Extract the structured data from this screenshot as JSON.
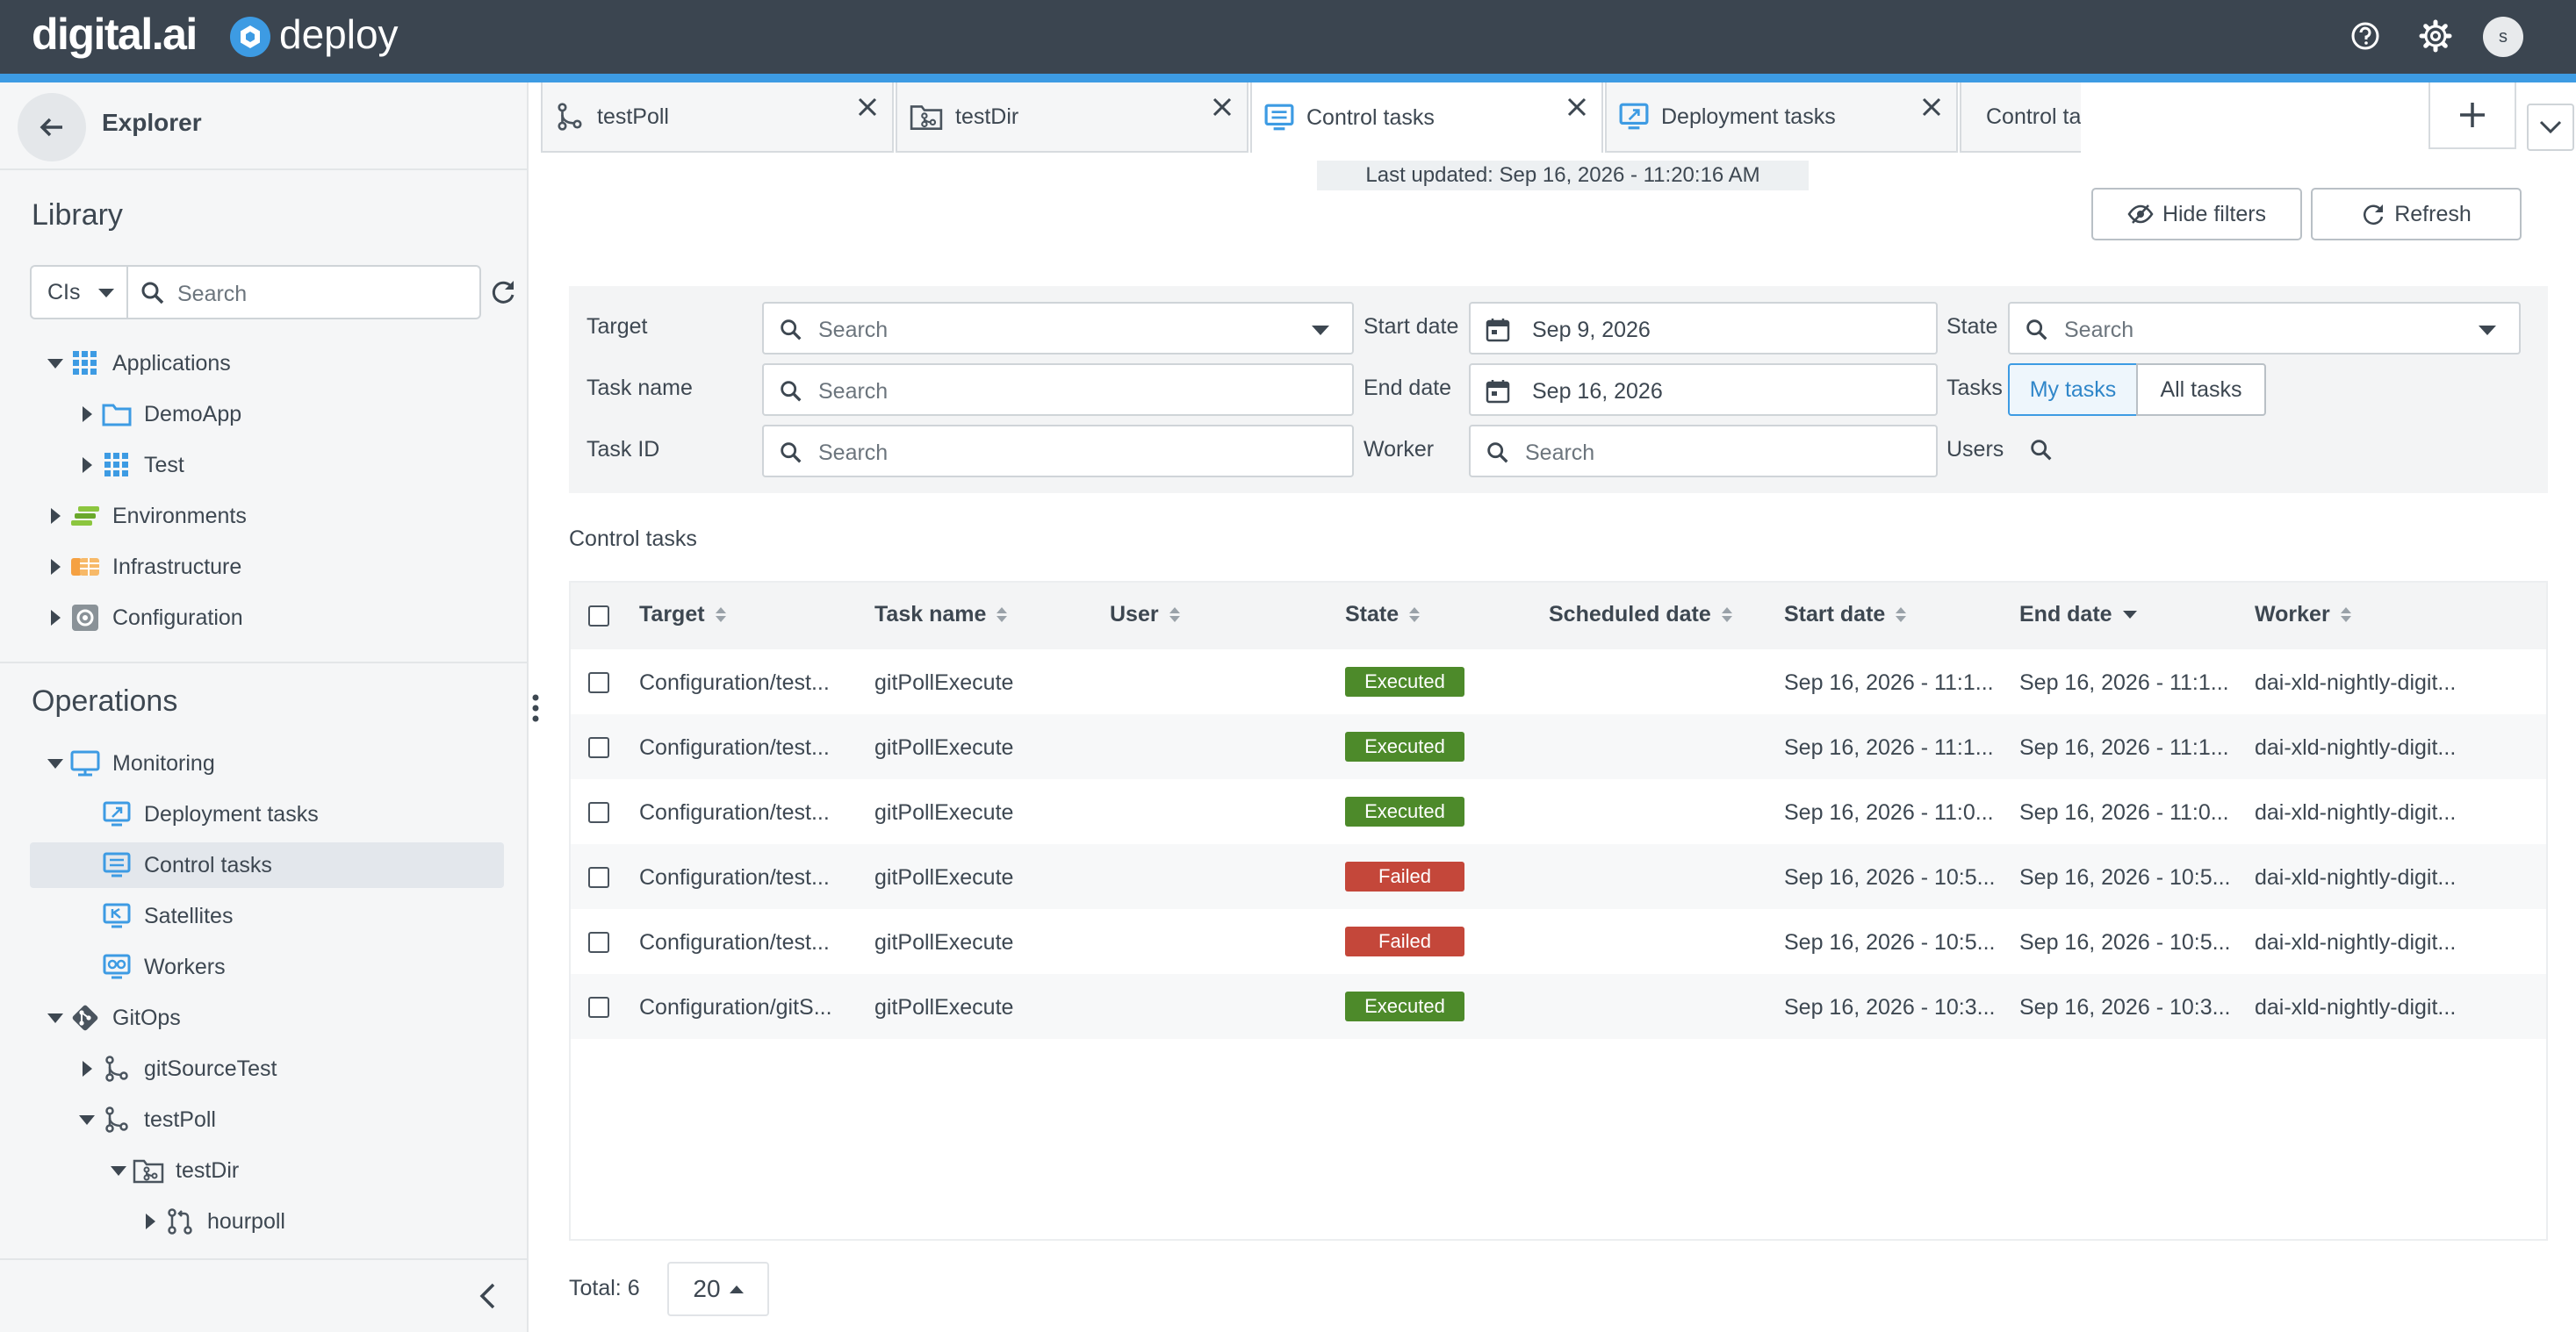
{
  "header": {
    "brand": "digital.ai",
    "product": "deploy",
    "user_initial": "s",
    "icons": [
      "help-icon",
      "settings-icon"
    ],
    "colors": {
      "bar": "#3b4550",
      "accent": "#3d9be3"
    }
  },
  "sidebar": {
    "title": "Explorer",
    "library_heading": "Library",
    "ci_select": "CIs",
    "search_placeholder": "Search",
    "tree": {
      "applications": "Applications",
      "demoapp": "DemoApp",
      "test": "Test",
      "environments": "Environments",
      "infrastructure": "Infrastructure",
      "configuration": "Configuration"
    },
    "operations_heading": "Operations",
    "ops": {
      "monitoring": "Monitoring",
      "deployment_tasks": "Deployment tasks",
      "control_tasks": "Control tasks",
      "satellites": "Satellites",
      "workers": "Workers",
      "gitops": "GitOps",
      "git_source_test": "gitSourceTest",
      "test_poll": "testPoll",
      "test_dir": "testDir",
      "hourpoll": "hourpoll"
    }
  },
  "tabs": [
    {
      "label": "testPoll"
    },
    {
      "label": "testDir"
    },
    {
      "label": "Control tasks"
    },
    {
      "label": "Deployment tasks"
    },
    {
      "label": "Control task [Execute Poll Now] for Confi"
    }
  ],
  "main": {
    "last_updated": "Last updated: Sep 16, 2026 - 11:20:16 AM",
    "hide_filters": "Hide filters",
    "refresh": "Refresh",
    "section_title": "Control tasks",
    "total": "Total: 6",
    "page_size": "20"
  },
  "filters": {
    "target_label": "Target",
    "task_name_label": "Task name",
    "task_id_label": "Task ID",
    "start_date_label": "Start date",
    "end_date_label": "End date",
    "worker_label": "Worker",
    "state_label": "State",
    "tasks_label": "Tasks",
    "users_label": "Users",
    "search_placeholder": "Search",
    "start_date": "Sep 9, 2026",
    "end_date": "Sep 16, 2026",
    "my_tasks": "My tasks",
    "all_tasks": "All tasks"
  },
  "table": {
    "columns": [
      "Target",
      "Task name",
      "User",
      "State",
      "Scheduled date",
      "Start date",
      "End date",
      "Worker"
    ],
    "rows": [
      {
        "target": "Configuration/test...",
        "task": "gitPollExecute",
        "user": "",
        "state": "Executed",
        "scheduled": "",
        "start": "Sep 16, 2026 - 11:1...",
        "end": "Sep 16, 2026 - 11:1...",
        "worker": "dai-xld-nightly-digit..."
      },
      {
        "target": "Configuration/test...",
        "task": "gitPollExecute",
        "user": "",
        "state": "Executed",
        "scheduled": "",
        "start": "Sep 16, 2026 - 11:1...",
        "end": "Sep 16, 2026 - 11:1...",
        "worker": "dai-xld-nightly-digit..."
      },
      {
        "target": "Configuration/test...",
        "task": "gitPollExecute",
        "user": "",
        "state": "Executed",
        "scheduled": "",
        "start": "Sep 16, 2026 - 11:0...",
        "end": "Sep 16, 2026 - 11:0...",
        "worker": "dai-xld-nightly-digit..."
      },
      {
        "target": "Configuration/test...",
        "task": "gitPollExecute",
        "user": "",
        "state": "Failed",
        "scheduled": "",
        "start": "Sep 16, 2026 - 10:5...",
        "end": "Sep 16, 2026 - 10:5...",
        "worker": "dai-xld-nightly-digit..."
      },
      {
        "target": "Configuration/test...",
        "task": "gitPollExecute",
        "user": "",
        "state": "Failed",
        "scheduled": "",
        "start": "Sep 16, 2026 - 10:5...",
        "end": "Sep 16, 2026 - 10:5...",
        "worker": "dai-xld-nightly-digit..."
      },
      {
        "target": "Configuration/gitS...",
        "task": "gitPollExecute",
        "user": "",
        "state": "Executed",
        "scheduled": "",
        "start": "Sep 16, 2026 - 10:3...",
        "end": "Sep 16, 2026 - 10:3...",
        "worker": "dai-xld-nightly-digit..."
      }
    ],
    "state_colors": {
      "Executed": "#4d8a2a",
      "Failed": "#c4473a"
    }
  }
}
